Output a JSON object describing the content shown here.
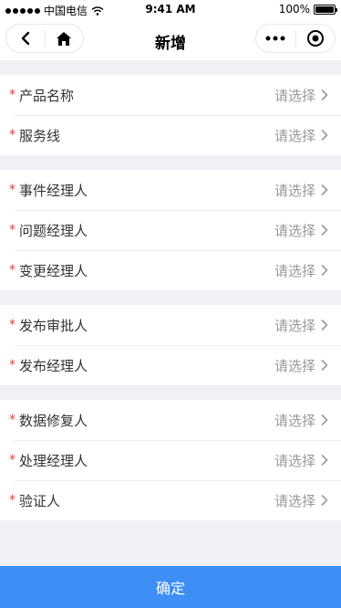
{
  "status_bar": {
    "carrier": "中国电信",
    "time": "9:41 AM",
    "battery": "100%"
  },
  "nav": {
    "title": "新增"
  },
  "groups": [
    {
      "rows": [
        {
          "label": "产品名称",
          "placeholder": "请选择"
        },
        {
          "label": "服务线",
          "placeholder": "请选择"
        }
      ]
    },
    {
      "rows": [
        {
          "label": "事件经理人",
          "placeholder": "请选择"
        },
        {
          "label": "问题经理人",
          "placeholder": "请选择"
        },
        {
          "label": "变更经理人",
          "placeholder": "请选择"
        }
      ]
    },
    {
      "rows": [
        {
          "label": "发布审批人",
          "placeholder": "请选择"
        },
        {
          "label": "发布经理人",
          "placeholder": "请选择"
        }
      ]
    },
    {
      "rows": [
        {
          "label": "数据修复人",
          "placeholder": "请选择"
        },
        {
          "label": "处理经理人",
          "placeholder": "请选择"
        },
        {
          "label": "验证人",
          "placeholder": "请选择"
        }
      ]
    }
  ],
  "required_mark": "*",
  "confirm_label": "确定",
  "colors": {
    "accent": "#3d8ef5",
    "required": "#e0403a",
    "placeholder": "#999999",
    "background": "#f0f1f5"
  }
}
